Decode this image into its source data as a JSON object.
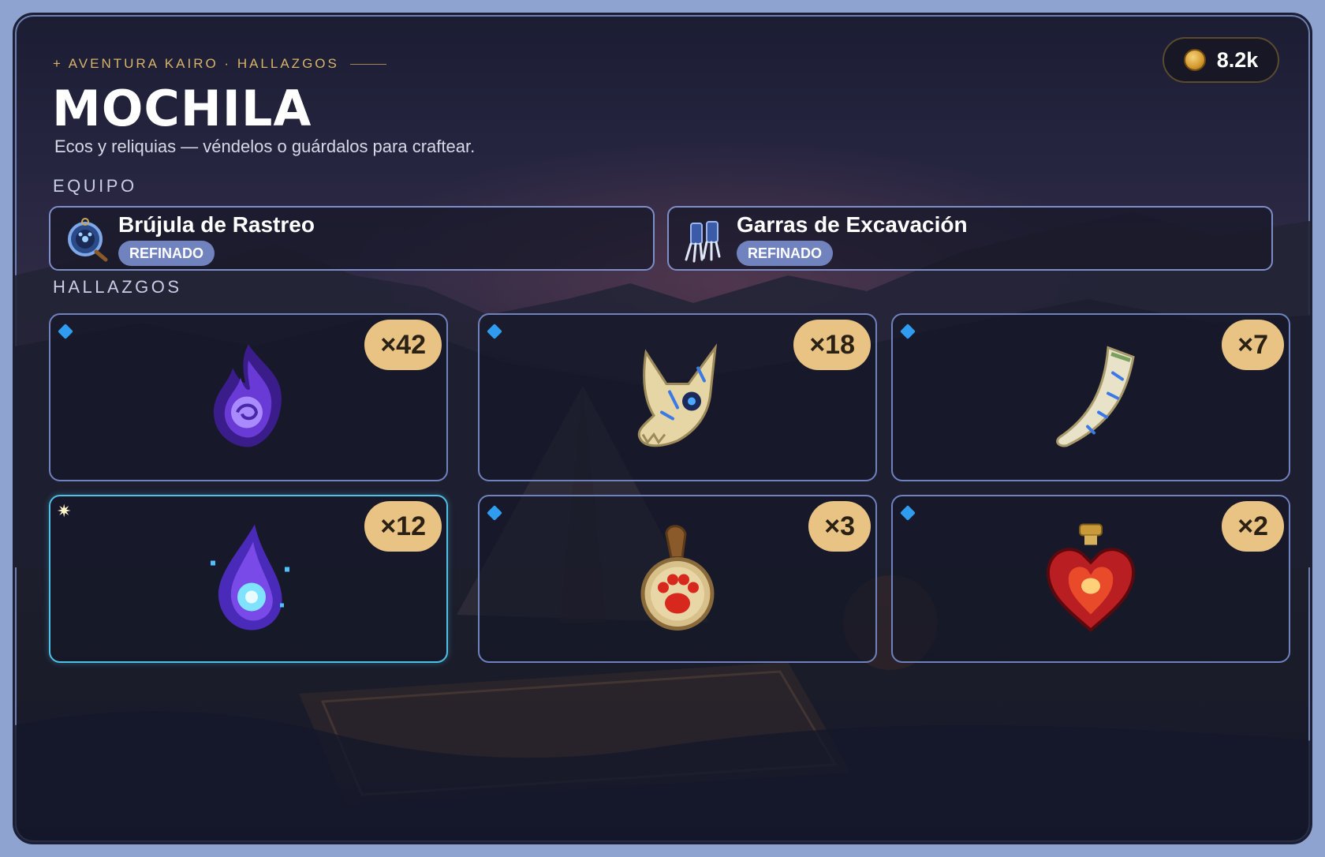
{
  "header": {
    "breadcrumb": "+ AVENTURA KAIRO · HALLAZGOS",
    "title": "MOCHILA",
    "subtitle": "Ecos y reliquias — véndelos o guárdalos para craftear."
  },
  "wallet": {
    "coins": "8.2k",
    "icon": "coin-icon"
  },
  "sections": {
    "equipment": "EQUIPO",
    "findings": "HALLAZGOS"
  },
  "equipment": [
    {
      "name": "Brújula de Rastreo",
      "badge": "REFINADO",
      "icon": "compass-icon"
    },
    {
      "name": "Garras de Excavación",
      "badge": "REFINADO",
      "icon": "claws-icon"
    }
  ],
  "findings": [
    {
      "icon": "purple-flame-icon",
      "qty": "×42",
      "marker": "gem"
    },
    {
      "icon": "wolf-skull-icon",
      "qty": "×18",
      "marker": "gem"
    },
    {
      "icon": "runic-horn-icon",
      "qty": "×7",
      "marker": "gem"
    },
    {
      "icon": "spirit-droplet-icon",
      "qty": "×12",
      "marker": "spark"
    },
    {
      "icon": "paw-amulet-icon",
      "qty": "×3",
      "marker": "gem"
    },
    {
      "icon": "heart-potion-icon",
      "qty": "×2",
      "marker": "gem"
    }
  ],
  "colors": {
    "accent_gold": "#e9c383",
    "border": "#6f82bd",
    "highlight_border": "#4fc0e6",
    "badge": "#7083bf",
    "gem": "#2f9cf0"
  }
}
